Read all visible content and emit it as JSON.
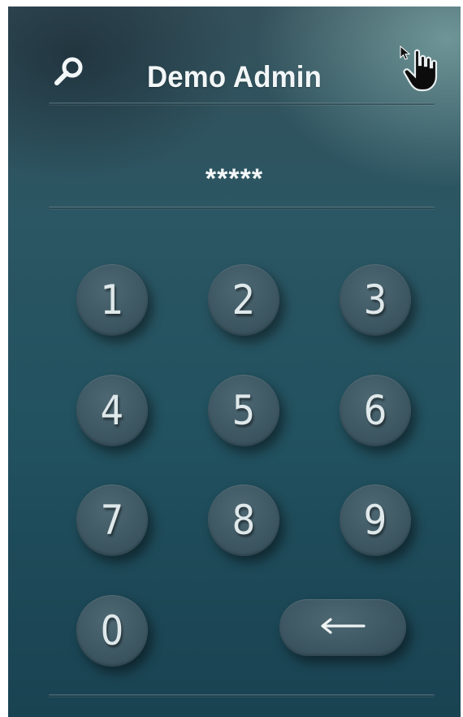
{
  "header": {
    "title": "Demo Admin",
    "left_icon": "search-icon",
    "right_icon": "hand-pointer-cursor-icon"
  },
  "pin_display": {
    "masked_value": "*****"
  },
  "keypad": {
    "keys": [
      "1",
      "2",
      "3",
      "4",
      "5",
      "6",
      "7",
      "8",
      "9",
      "0"
    ],
    "backspace_icon": "arrow-left-icon"
  },
  "colors": {
    "background_top": "#34505a",
    "background_bottom": "#1a4352",
    "key_fill": "#3e5863",
    "text": "#f2f6f7"
  }
}
